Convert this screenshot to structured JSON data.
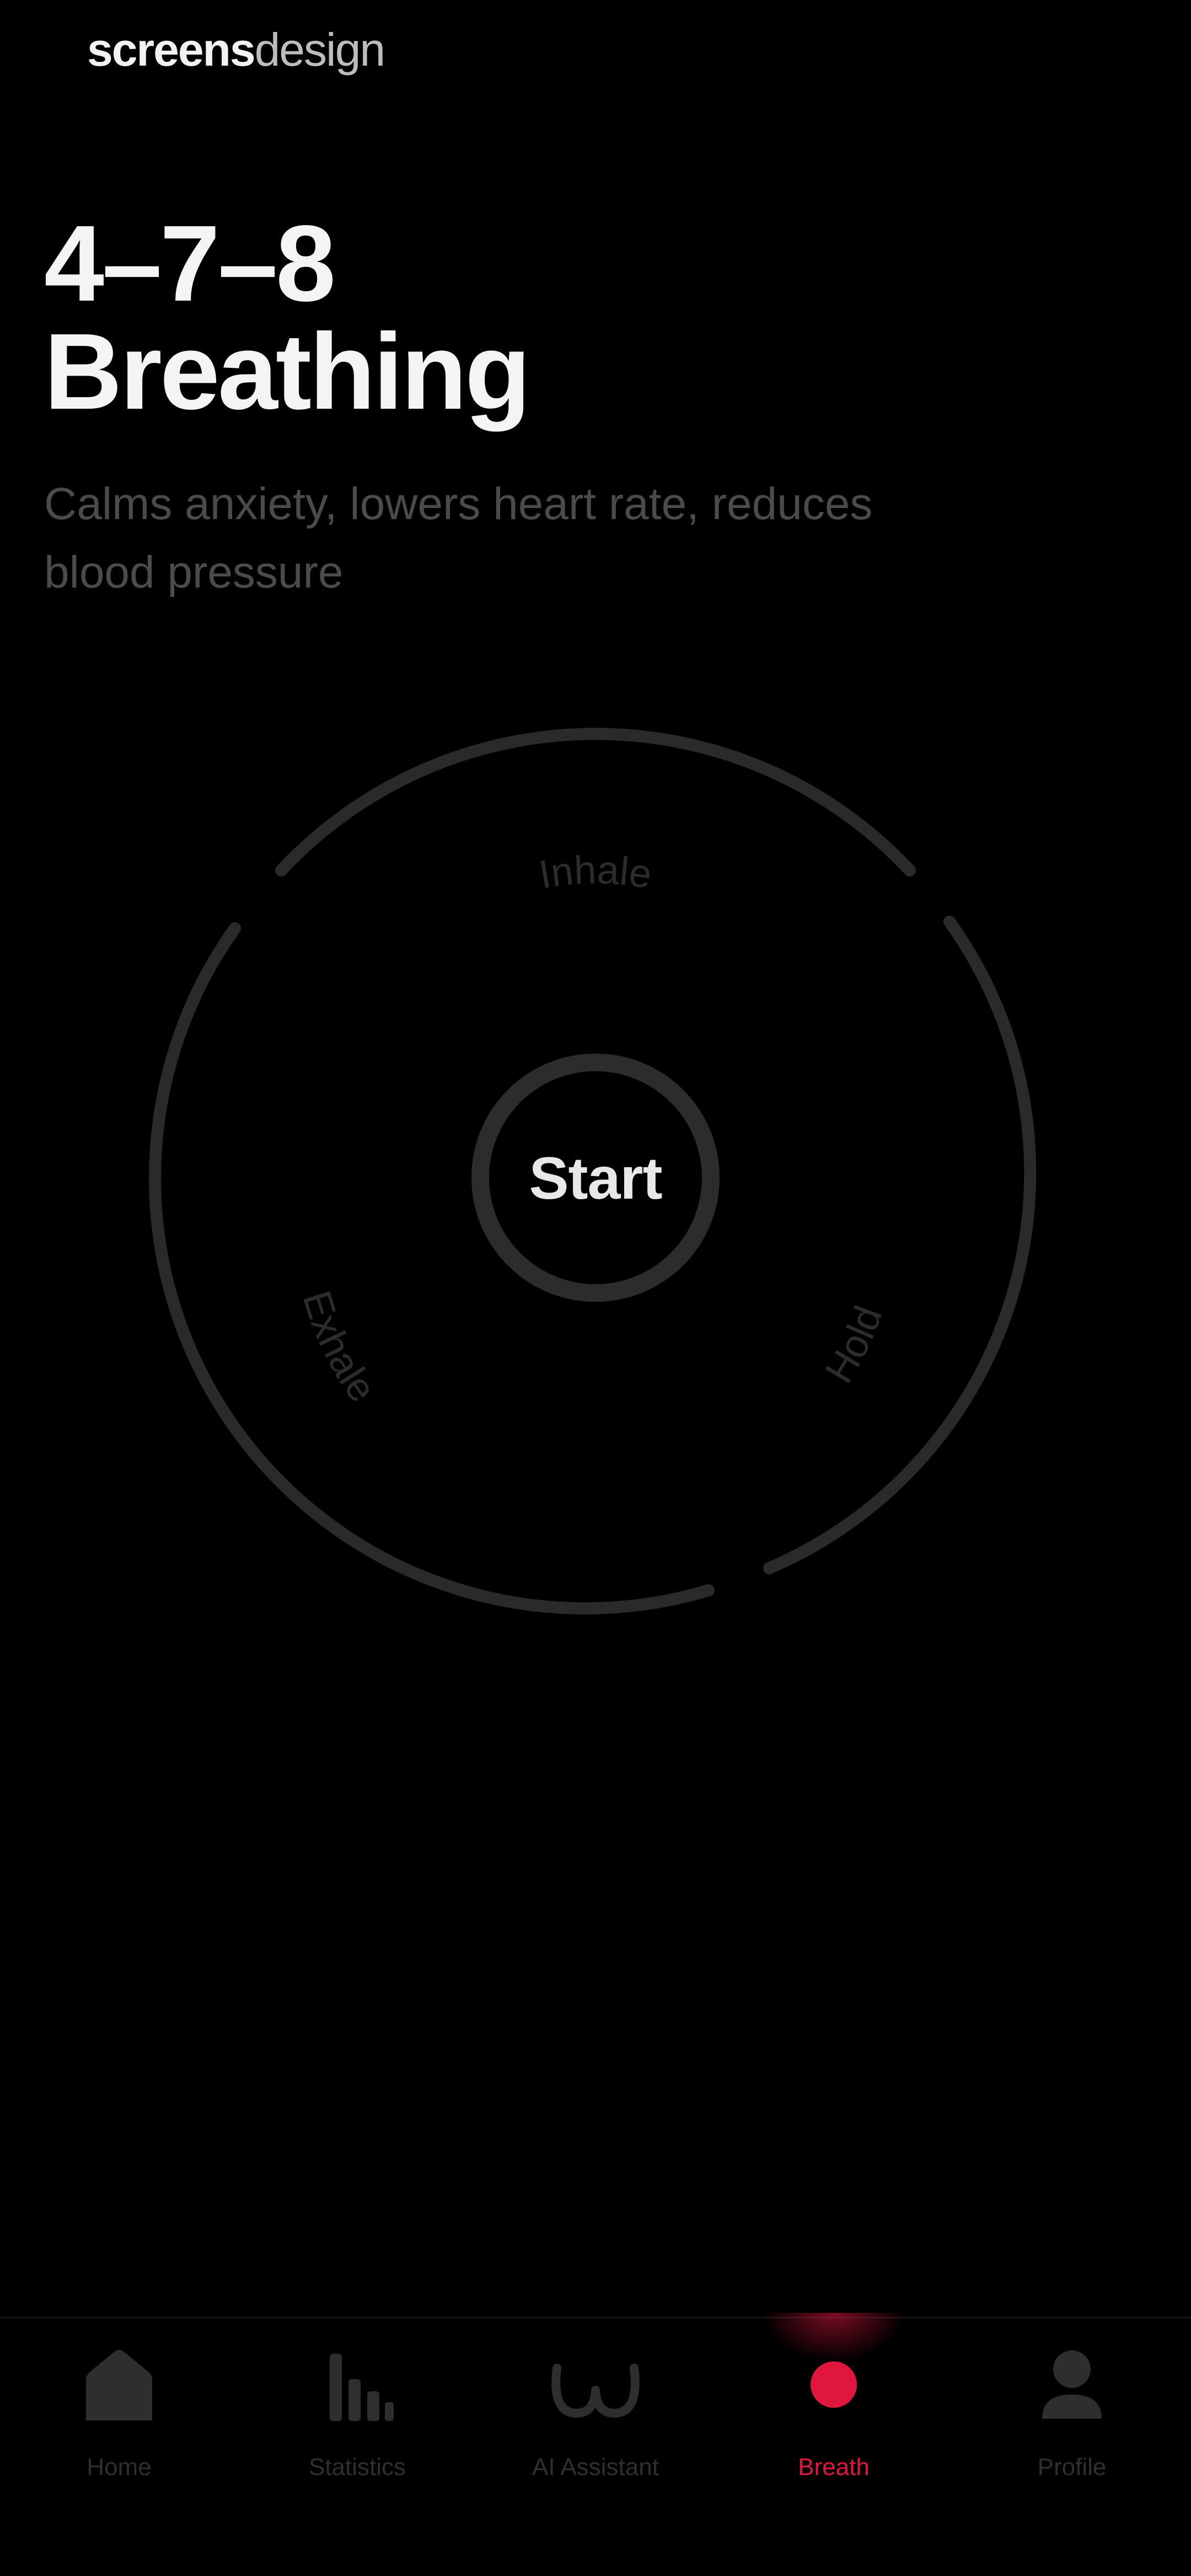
{
  "app": {
    "brand": {
      "bold": "screens",
      "light": "design"
    }
  },
  "header": {
    "title_line1": "4–7–8",
    "title_line2": "Breathing",
    "subtitle": "Calms anxiety, lowers heart rate, reduces blood pressure"
  },
  "breath": {
    "inhale_label": "Inhale",
    "hold_label": "Hold",
    "exhale_label": "Exhale",
    "start_label": "Start"
  },
  "tabs": [
    {
      "label": "Home",
      "icon": "home-icon",
      "active": false
    },
    {
      "label": "Statistics",
      "icon": "bar-chart-icon",
      "active": false
    },
    {
      "label": "AI Assistant",
      "icon": "ai-assistant-icon",
      "active": false
    },
    {
      "label": "Breath",
      "icon": "breath-dot-icon",
      "active": true
    },
    {
      "label": "Profile",
      "icon": "profile-icon",
      "active": false
    }
  ],
  "colors": {
    "background": "#000000",
    "ring": "#2a2a2a",
    "accent": "#e0163f",
    "muted_text": "#4b4b4b"
  }
}
